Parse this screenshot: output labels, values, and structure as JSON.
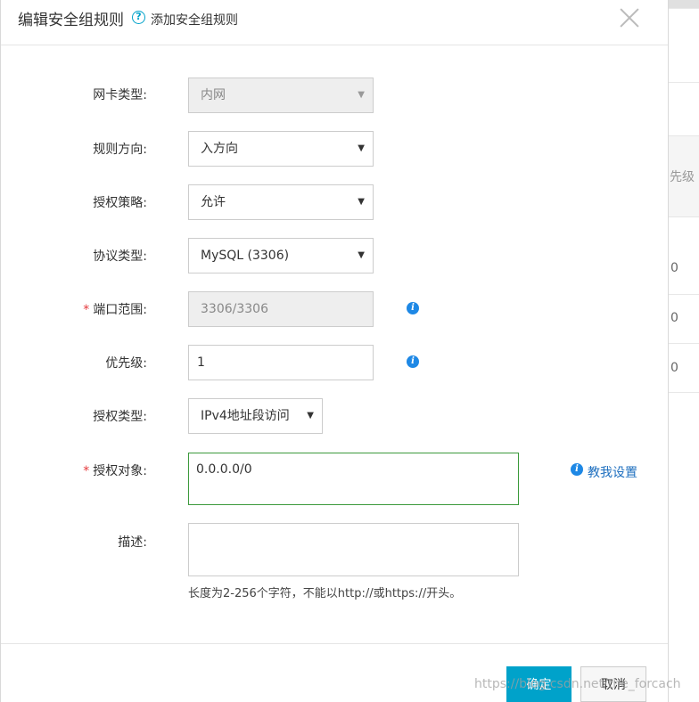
{
  "dialog": {
    "title": "编辑安全组规则",
    "help_icon": "?",
    "help_link": "添加安全组规则"
  },
  "form": {
    "nic_type": {
      "label": "网卡类型:",
      "value": "内网",
      "disabled": true
    },
    "direction": {
      "label": "规则方向:",
      "value": "入方向"
    },
    "policy": {
      "label": "授权策略:",
      "value": "允许"
    },
    "protocol": {
      "label": "协议类型:",
      "value": "MySQL (3306)"
    },
    "port_range": {
      "label": "端口范围:",
      "value": "3306/3306",
      "required_mark": "*",
      "disabled": true
    },
    "priority": {
      "label": "优先级:",
      "value": "1"
    },
    "auth_type": {
      "label": "授权类型:",
      "value": "IPv4地址段访问"
    },
    "auth_object": {
      "label": "授权对象:",
      "value": "0.0.0.0/0",
      "required_mark": "*",
      "teach_link": "教我设置"
    },
    "description": {
      "label": "描述:",
      "value": "",
      "hint": "长度为2-256个字符，不能以http://或https://开头。"
    }
  },
  "footer": {
    "confirm": "确定",
    "cancel": "取消"
  },
  "background": {
    "header_text": "先级",
    "cell_values": [
      "0",
      "0",
      "0"
    ]
  },
  "watermark": "https://blog.csdn.net/the_forcach",
  "colors": {
    "primary": "#00a2ca",
    "link": "#1e6fbf",
    "required": "#e4393c",
    "focus_border": "#3c9a3c"
  }
}
